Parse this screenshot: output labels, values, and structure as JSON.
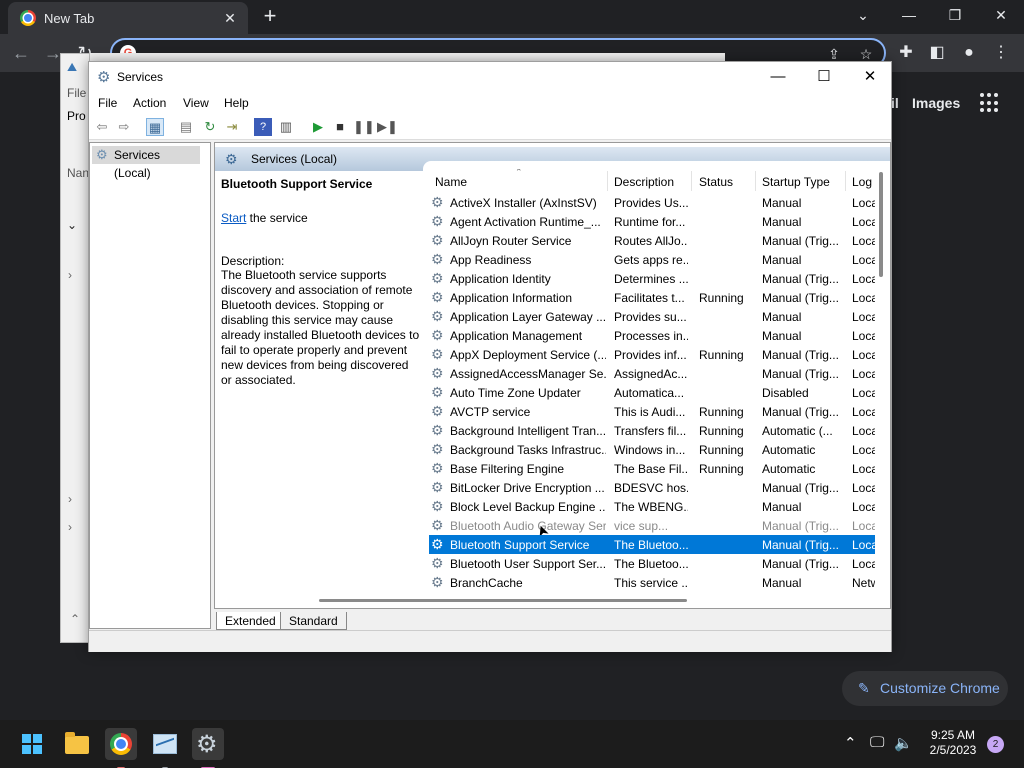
{
  "chrome": {
    "tab_title": "New Tab",
    "gmail_fragment": "il",
    "images_link": "Images",
    "customize_label": "Customize Chrome"
  },
  "background_window": {
    "menu_fragment": "File",
    "tab_fragment": "Pro",
    "col_fragment": "Nan"
  },
  "services_window": {
    "title": "Services",
    "menu": [
      "File",
      "Action",
      "View",
      "Help"
    ],
    "tree_item": "Services (Local)",
    "header_title": "Services (Local)",
    "selected_service_name": "Bluetooth Support Service",
    "start_link": "Start",
    "start_suffix": " the service",
    "description_label": "Description:",
    "description_text": "The Bluetooth service supports discovery and association of remote Bluetooth devices.  Stopping or disabling this service may cause already installed Bluetooth devices to fail to operate properly and prevent new devices from being discovered or associated.",
    "columns": [
      "Name",
      "Description",
      "Status",
      "Startup Type",
      "Log"
    ],
    "rows": [
      {
        "name": "ActiveX Installer (AxInstSV)",
        "desc": "Provides Us...",
        "status": "",
        "startup": "Manual",
        "log": "Loca"
      },
      {
        "name": "Agent Activation Runtime_...",
        "desc": "Runtime for...",
        "status": "",
        "startup": "Manual",
        "log": "Loca"
      },
      {
        "name": "AllJoyn Router Service",
        "desc": "Routes AllJo...",
        "status": "",
        "startup": "Manual (Trig...",
        "log": "Loca"
      },
      {
        "name": "App Readiness",
        "desc": "Gets apps re...",
        "status": "",
        "startup": "Manual",
        "log": "Loca"
      },
      {
        "name": "Application Identity",
        "desc": "Determines ...",
        "status": "",
        "startup": "Manual (Trig...",
        "log": "Loca"
      },
      {
        "name": "Application Information",
        "desc": "Facilitates t...",
        "status": "Running",
        "startup": "Manual (Trig...",
        "log": "Loca"
      },
      {
        "name": "Application Layer Gateway ...",
        "desc": "Provides su...",
        "status": "",
        "startup": "Manual",
        "log": "Loca"
      },
      {
        "name": "Application Management",
        "desc": "Processes in...",
        "status": "",
        "startup": "Manual",
        "log": "Loca"
      },
      {
        "name": "AppX Deployment Service (...",
        "desc": "Provides inf...",
        "status": "Running",
        "startup": "Manual (Trig...",
        "log": "Loca"
      },
      {
        "name": "AssignedAccessManager Se...",
        "desc": "AssignedAc...",
        "status": "",
        "startup": "Manual (Trig...",
        "log": "Loca"
      },
      {
        "name": "Auto Time Zone Updater",
        "desc": "Automatica...",
        "status": "",
        "startup": "Disabled",
        "log": "Loca"
      },
      {
        "name": "AVCTP service",
        "desc": "This is Audi...",
        "status": "Running",
        "startup": "Manual (Trig...",
        "log": "Loca"
      },
      {
        "name": "Background Intelligent Tran...",
        "desc": "Transfers fil...",
        "status": "Running",
        "startup": "Automatic (...",
        "log": "Loca"
      },
      {
        "name": "Background Tasks Infrastruc...",
        "desc": "Windows in...",
        "status": "Running",
        "startup": "Automatic",
        "log": "Loca"
      },
      {
        "name": "Base Filtering Engine",
        "desc": "The Base Fil...",
        "status": "Running",
        "startup": "Automatic",
        "log": "Loca"
      },
      {
        "name": "BitLocker Drive Encryption ...",
        "desc": "BDESVC hos...",
        "status": "",
        "startup": "Manual (Trig...",
        "log": "Loca"
      },
      {
        "name": "Block Level Backup Engine ...",
        "desc": "The WBENG...",
        "status": "",
        "startup": "Manual",
        "log": "Loca"
      },
      {
        "name": "Bluetooth Audio Gateway Service",
        "desc": "vice sup...",
        "status": "",
        "startup": "Manual (Trig...",
        "log": "Loca",
        "dragged": true
      },
      {
        "name": "Bluetooth Support Service",
        "desc": "The Bluetoo...",
        "status": "",
        "startup": "Manual (Trig...",
        "log": "Loca",
        "selected": true
      },
      {
        "name": "Bluetooth User Support Ser...",
        "desc": "The Bluetoo...",
        "status": "",
        "startup": "Manual (Trig...",
        "log": "Loca"
      },
      {
        "name": "BranchCache",
        "desc": "This service ...",
        "status": "",
        "startup": "Manual",
        "log": "Netw"
      }
    ],
    "view_tabs": [
      "Extended",
      "Standard"
    ]
  },
  "taskbar": {
    "time": "9:25 AM",
    "date": "2/5/2023",
    "notification_count": "2"
  },
  "colors": {
    "selection": "#0078d7",
    "link": "#0a5bc4",
    "chrome_accent": "#8ab4f8"
  }
}
